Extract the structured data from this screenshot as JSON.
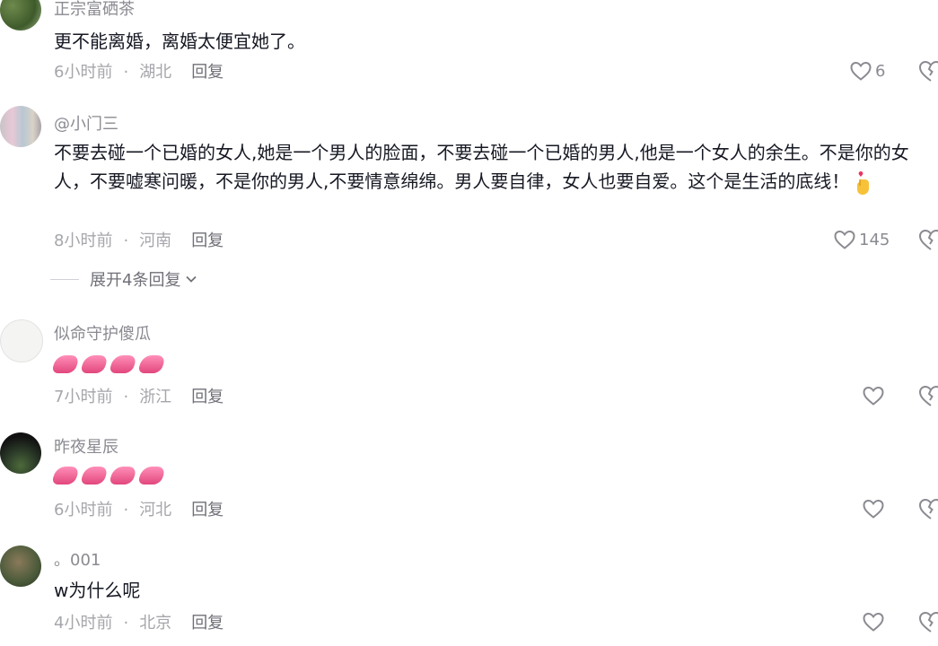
{
  "comments": [
    {
      "username": "正宗富硒茶",
      "text": "更不能离婚，离婚太便宜她了。",
      "time": "6小时前",
      "location": "湖北",
      "reply": "回复",
      "likes": "6"
    },
    {
      "username": "@小门三",
      "text": "不要去碰一个已婚的女人,她是一个男人的脸面，不要去碰一个已婚的男人,他是一个女人的余生。不是你的女人，不要嘘寒问暖，不是你的男人,不要情意绵绵。男人要自律，女人也要自爱。这个是生活的底线！",
      "time": "8小时前",
      "location": "河南",
      "reply": "回复",
      "likes": "145",
      "expand_label": "展开4条回复"
    },
    {
      "username": "似命守护傻瓜",
      "time": "7小时前",
      "location": "浙江",
      "reply": "回复"
    },
    {
      "username": "昨夜星辰",
      "time": "6小时前",
      "location": "河北",
      "reply": "回复"
    },
    {
      "username": "。001",
      "text": "w为什么呢",
      "time": "4小时前",
      "location": "北京",
      "reply": "回复"
    }
  ],
  "colors": {
    "text": "#161823",
    "meta": "#a5a6ab",
    "emoji_pink": "#e2477d"
  },
  "icons": {
    "like": "heart-outline-icon",
    "dislike": "broken-heart-icon",
    "expand": "chevron-down-icon",
    "emoji": "pink-fingernails-emoji",
    "emoji_heart_hand": "finger-heart-emoji"
  }
}
